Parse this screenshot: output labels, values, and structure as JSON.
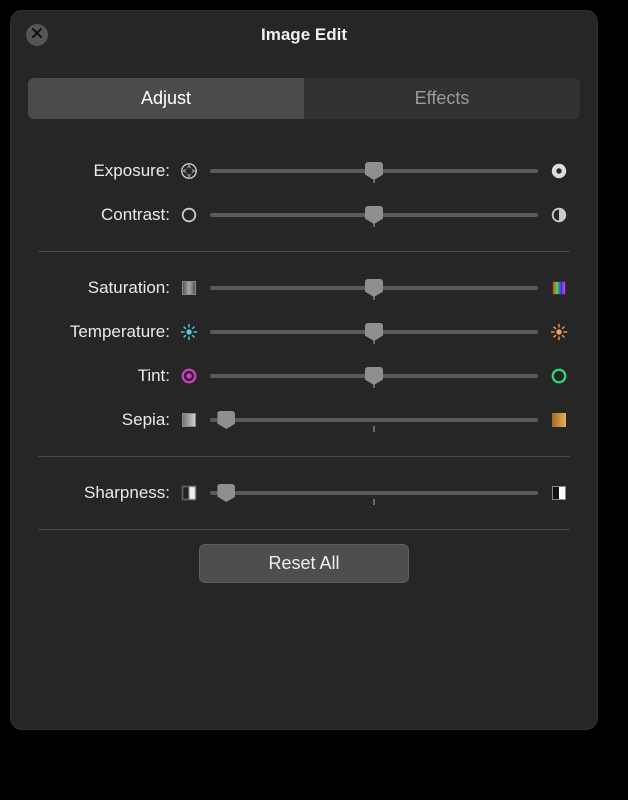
{
  "window": {
    "title": "Image Edit"
  },
  "tabs": {
    "adjust": "Adjust",
    "effects": "Effects",
    "active": "adjust"
  },
  "sliders": {
    "exposure": {
      "label": "Exposure:",
      "value": 50,
      "tick": 50
    },
    "contrast": {
      "label": "Contrast:",
      "value": 50,
      "tick": 50
    },
    "saturation": {
      "label": "Saturation:",
      "value": 50,
      "tick": 50
    },
    "temperature": {
      "label": "Temperature:",
      "value": 50,
      "tick": 50
    },
    "tint": {
      "label": "Tint:",
      "value": 50,
      "tick": 50
    },
    "sepia": {
      "label": "Sepia:",
      "value": 5,
      "tick": 50
    },
    "sharpness": {
      "label": "Sharpness:",
      "value": 5,
      "tick": 50
    }
  },
  "buttons": {
    "reset_all": "Reset All"
  },
  "colors": {
    "magenta": "#d63cc3",
    "green": "#2fd67a",
    "sepia": "#c98a2e"
  }
}
